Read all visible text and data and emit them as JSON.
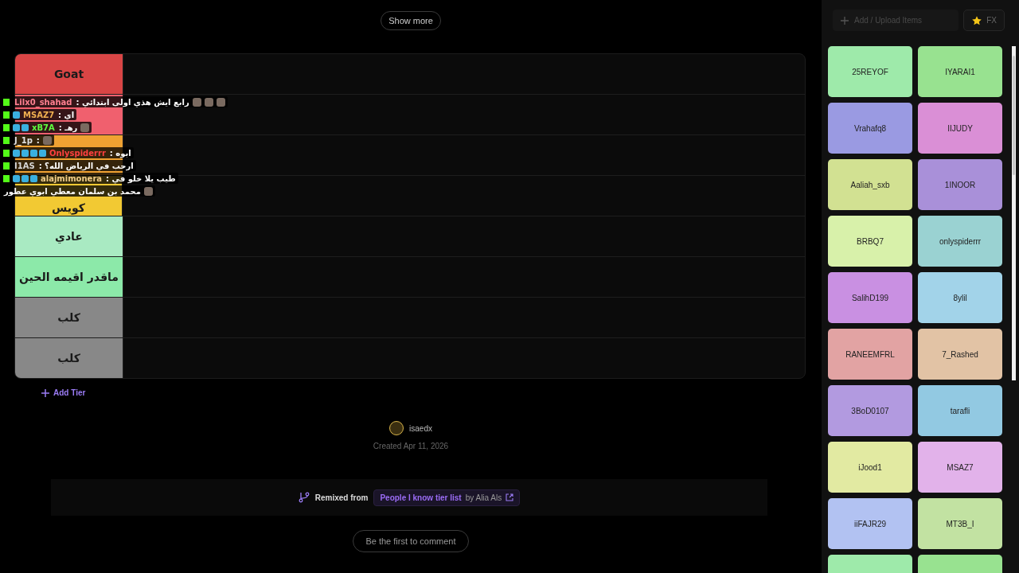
{
  "show_more": "Show more",
  "tiers": [
    {
      "label": "Goat",
      "color": "#d94545"
    },
    {
      "color": "#f0606e"
    },
    {
      "color": "#f0a232"
    },
    {
      "label": "كويس",
      "color": "#f2c933"
    },
    {
      "label": "عادي",
      "color": "#a9eac2"
    },
    {
      "label": "ماقدر اقيمه الحين",
      "color": "#8ce9a9"
    },
    {
      "label": "كلب",
      "color": "#888888"
    },
    {
      "label": "كلب",
      "color": "#888888"
    }
  ],
  "add_tier": "Add Tier",
  "author": {
    "name": "isaedx",
    "created": "Created Apr 11, 2026"
  },
  "remix": {
    "label": "Remixed from",
    "title": "People I know tier list",
    "by": "by Alia Als"
  },
  "comment_button": "Be the first to comment",
  "sidebar": {
    "add_placeholder": "Add / Upload Items",
    "fx": "FX",
    "items": [
      {
        "name": "25REYOF",
        "color": "#9eeaaa"
      },
      {
        "name": "IYARAI1",
        "color": "#98e290"
      },
      {
        "name": "Vrahafq8",
        "color": "#9a9ae2"
      },
      {
        "name": "IIJUDY",
        "color": "#da8fd6"
      },
      {
        "name": "Aaliah_sxb",
        "color": "#d2e192"
      },
      {
        "name": "1INOOR",
        "color": "#a990d9"
      },
      {
        "name": "BRBQ7",
        "color": "#d8f1aa"
      },
      {
        "name": "onlyspiderrr",
        "color": "#9ad2d2"
      },
      {
        "name": "SalihD199",
        "color": "#c990e2"
      },
      {
        "name": "8ylil",
        "color": "#a2d3e9"
      },
      {
        "name": "RANEEMFRL",
        "color": "#e2a3a3"
      },
      {
        "name": "7_Rashed",
        "color": "#e2c3a5"
      },
      {
        "name": "3BoD0107",
        "color": "#b29ae0"
      },
      {
        "name": "tarafli",
        "color": "#92c9e2"
      },
      {
        "name": "iJood1",
        "color": "#e2eaa2"
      },
      {
        "name": "MSAZ7",
        "color": "#e2b2ea"
      },
      {
        "name": "iiFAJR29",
        "color": "#b2c2f2"
      },
      {
        "name": "MT3B_I",
        "color": "#c2e2a2"
      },
      {
        "color": "#9eeaaa"
      },
      {
        "color": "#98e290"
      }
    ]
  },
  "chat": [
    {
      "user": "Lilx0_shahad",
      "message": ": رابع ايش هذي اولى ابتدائي"
    },
    {
      "user": "MSAZ7",
      "message": ": اي"
    },
    {
      "user": "xB7A",
      "message": ": رهـ"
    },
    {
      "user": "J_1p",
      "message": ":"
    },
    {
      "user": "Onlyspiderrr",
      "message": ": ابوه"
    },
    {
      "user": "I1AS",
      "message": ": ارحب في الرياض الله؟"
    },
    {
      "user": "alajmimonera",
      "message": ": طيب يلا خلو في"
    },
    {
      "message": "محمد بن سلمان معطي ابوي عطور"
    }
  ]
}
